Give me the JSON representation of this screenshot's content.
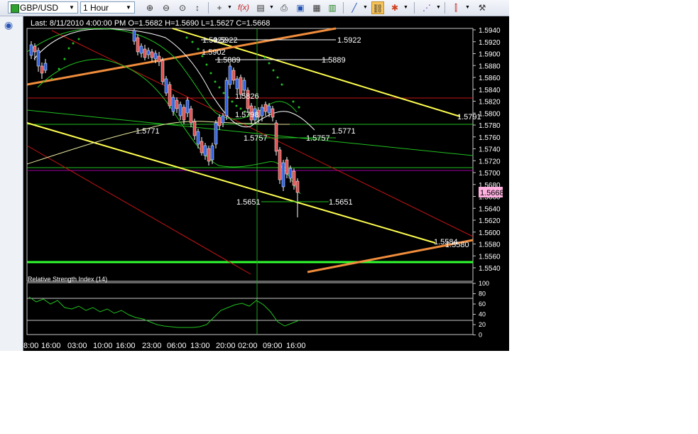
{
  "toolbar": {
    "symbol": "GBP/USD",
    "timeframe": "1 Hour",
    "icons": [
      "zoom-in-icon",
      "zoom-out-icon",
      "zoom-fit-icon",
      "vertical-scale-icon",
      "crosshair-icon",
      "function-icon",
      "chart-properties-icon",
      "print-icon",
      "save-icon",
      "template-icon",
      "save-template-icon",
      "line-tool-icon",
      "link-icon",
      "cursor-icon",
      "indicator-icon",
      "bar-type-icon",
      "tools-icon"
    ]
  },
  "chart": {
    "header": "Last: 8/11/2010 4:00:00 PM O=1.5682 H=1.5690 L=1.5627 C=1.5668",
    "price_axis": [
      "1.5940",
      "1.5920",
      "1.5900",
      "1.5880",
      "1.5860",
      "1.5840",
      "1.5820",
      "1.5800",
      "1.5780",
      "1.5760",
      "1.5740",
      "1.5720",
      "1.5700",
      "1.5680",
      "1.5660",
      "1.5640",
      "1.5620",
      "1.5600",
      "1.5580",
      "1.5560",
      "1.5540"
    ],
    "current_price": "1.5668",
    "time_axis": [
      "8:00",
      "16:00",
      "03:00",
      "10:00",
      "16:00",
      "23:00",
      "06:00",
      "13:00",
      "20:00",
      "02:00",
      "09:00",
      "16:00"
    ],
    "level_labels": {
      "l5922a": "1.5922",
      "l5922b": "1.5922",
      "l5902": "1.5902",
      "l5889a": "1.5889",
      "l5889b": "1.5889",
      "l5826": "1.5826",
      "l5798": "1.5798",
      "l5771a": "1.5771",
      "l5771b": "1.5771",
      "l5757a": "1.5757",
      "l5757b": "1.5757",
      "l5651a": "1.5651",
      "l5651b": "1.5651",
      "l5791": "1.5791",
      "l5584": "1.5584",
      "l5580": "1.5580"
    },
    "colors": {
      "orange_line": "#f08c3c",
      "yellow_line": "#ffff50",
      "red_line": "#c81414",
      "green_line": "#20c020",
      "bright_green_line": "#30ff30",
      "purple_line": "#a060a0",
      "current_price_bg": "#ffb0e0"
    }
  },
  "rsi": {
    "title": "Relative Strength Index (14)",
    "axis": [
      "100",
      "80",
      "60",
      "40",
      "20",
      "0"
    ]
  }
}
